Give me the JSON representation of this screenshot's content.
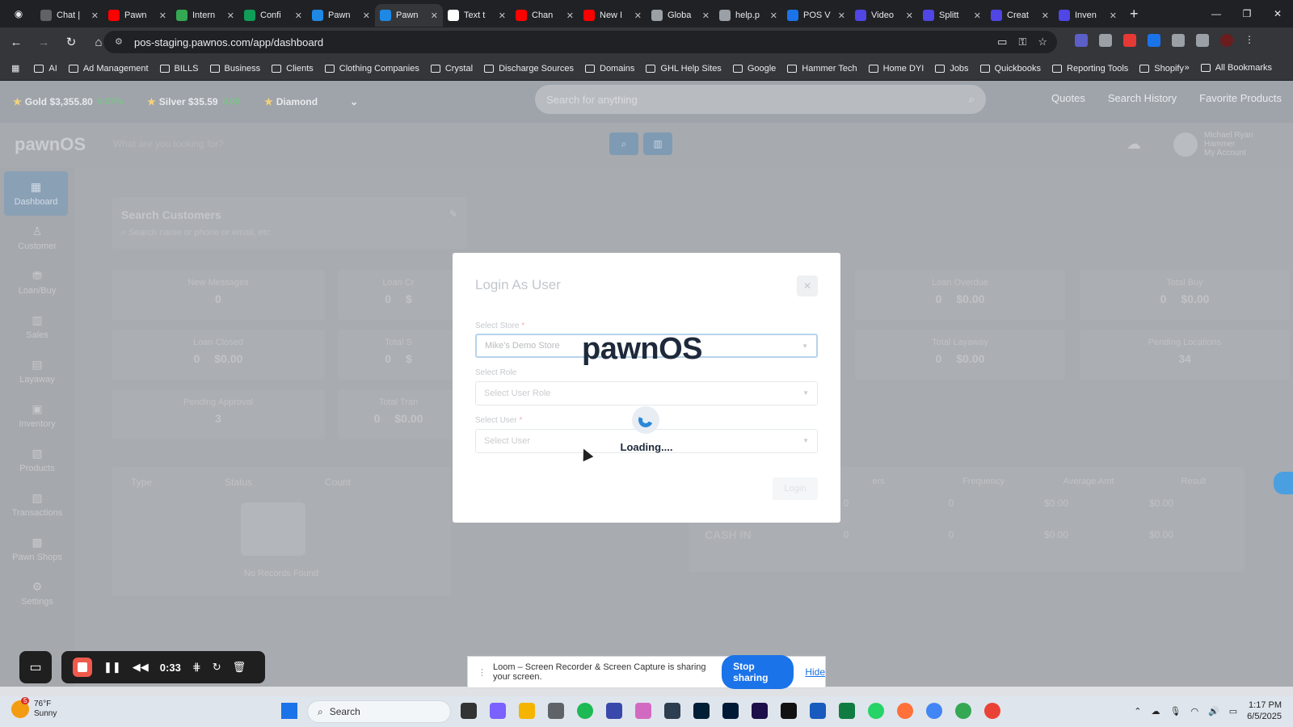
{
  "browser": {
    "tabs": [
      {
        "label": "Chat |",
        "color": "#5f6368",
        "active": false
      },
      {
        "label": "Pawn",
        "color": "#ff0000",
        "active": false
      },
      {
        "label": "Intern",
        "color": "#34a853",
        "active": false
      },
      {
        "label": "Confi",
        "color": "#0f9d58",
        "active": false
      },
      {
        "label": "Pawn",
        "color": "#1e88e5",
        "active": false
      },
      {
        "label": "Pawn",
        "color": "#1e88e5",
        "active": true
      },
      {
        "label": "Text t",
        "color": "#ffffff",
        "active": false
      },
      {
        "label": "Chan",
        "color": "#ff0000",
        "active": false
      },
      {
        "label": "New I",
        "color": "#ff0000",
        "active": false
      },
      {
        "label": "Globa",
        "color": "#9aa0a6",
        "active": false
      },
      {
        "label": "help.p",
        "color": "#9aa0a6",
        "active": false
      },
      {
        "label": "POS V",
        "color": "#1a73e8",
        "active": false
      },
      {
        "label": "Video",
        "color": "#4f46e5",
        "active": false
      },
      {
        "label": "Splitt",
        "color": "#4f46e5",
        "active": false
      },
      {
        "label": "Creat",
        "color": "#4f46e5",
        "active": false
      },
      {
        "label": "Inven",
        "color": "#4f46e5",
        "active": false
      }
    ],
    "url": "pos-staging.pawnos.com/app/dashboard",
    "bookmarks": [
      "AI",
      "Ad Management",
      "BILLS",
      "Business",
      "Clients",
      "Clothing Companies",
      "Crystal",
      "Discharge Sources",
      "Domains",
      "GHL Help Sites",
      "Google",
      "Hammer Tech",
      "Home DYI",
      "Jobs",
      "Quickbooks",
      "Reporting Tools",
      "Shopify"
    ],
    "all_bookmarks": "All Bookmarks"
  },
  "topbar": {
    "gold": {
      "label": "Gold",
      "price": "$3,355.80",
      "change": "0.07%"
    },
    "silver": {
      "label": "Silver",
      "price": "$35.59",
      "change": "0.00"
    },
    "diamond": {
      "label": "Diamond"
    },
    "search_placeholder": "Search for anything",
    "links": [
      "Quotes",
      "Search History",
      "Favorite Products"
    ]
  },
  "header": {
    "logo": "pawnOS",
    "search_placeholder": "What are you looking for?",
    "user_name": "Michael Ryan Hammer",
    "user_sub": "My Account"
  },
  "sidebar": [
    "Dashboard",
    "Customer",
    "Loan/Buy",
    "Sales",
    "Layaway",
    "Inventory",
    "Products",
    "Transactions",
    "Pawn Shops",
    "Settings"
  ],
  "dashboard": {
    "search_customers_title": "Search Customers",
    "search_customers_placeholder": "Search name or phone or email, etc",
    "stats_left": [
      {
        "label": "New Messages",
        "value": "0"
      },
      {
        "label": "Loan Closed",
        "value": "0",
        "amount": "$0.00"
      },
      {
        "label": "Pending Approval",
        "value": "3"
      }
    ],
    "stats_mid": [
      {
        "label": "Loan Cr",
        "value": "0",
        "amount": "$"
      },
      {
        "label": "Total S",
        "value": "0",
        "amount": "$"
      },
      {
        "label": "Total Tran",
        "value": "0",
        "amount": "$0.00"
      }
    ],
    "stats_right": [
      {
        "label": "Loan Overdue",
        "value": "0",
        "amount": "$0.00"
      },
      {
        "label": "Total Buy",
        "value": "0",
        "amount": "$0.00"
      },
      {
        "label": "Total Layaway",
        "value": "0",
        "amount": "$0.00"
      },
      {
        "label": "Pending Locations",
        "value": "34"
      }
    ],
    "table_left_headers": [
      "Type",
      "Status",
      "Count"
    ],
    "no_records": "No Records Found",
    "table_right_headers": [
      "ers",
      "Frequency",
      "Average Amt",
      "Result"
    ],
    "table_right_rows": [
      {
        "label": "",
        "c1": "0",
        "c2": "0",
        "c3": "$0.00",
        "c4": "$0.00"
      },
      {
        "label": "CASH IN",
        "c1": "0",
        "c2": "0",
        "c3": "$0.00",
        "c4": "$0.00"
      }
    ]
  },
  "modal": {
    "title": "Login As User",
    "store_label": "Select Store",
    "store_value": "Mike's Demo Store",
    "role_label": "Select Role",
    "role_placeholder": "Select User Role",
    "user_label": "Select User",
    "user_placeholder": "Select User",
    "login_button": "Login",
    "required_mark": "*",
    "loader_logo": "pawnOS",
    "loading_text": "Loading...."
  },
  "loom": {
    "timer": "0:33",
    "share_message": "Loom – Screen Recorder & Screen Capture is sharing your screen.",
    "stop_sharing": "Stop sharing",
    "hide": "Hide"
  },
  "taskbar": {
    "temperature": "76°F",
    "weather": "Sunny",
    "weather_badge": "5",
    "search_label": "Search",
    "time": "1:17 PM",
    "date": "6/5/2025"
  }
}
